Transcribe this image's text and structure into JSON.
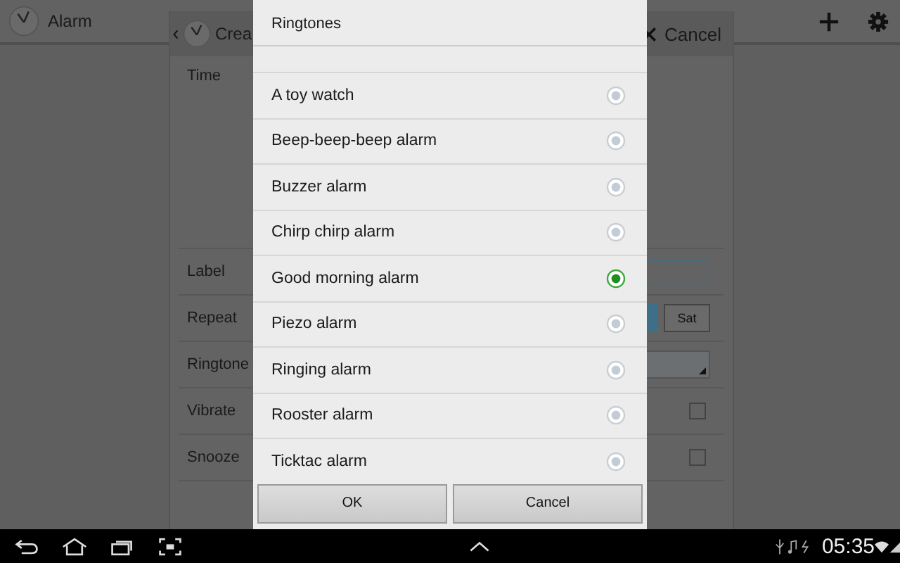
{
  "app_bar": {
    "title": "Alarm"
  },
  "panel": {
    "title": "Crea",
    "cancel": "Cancel",
    "rows": [
      {
        "label": "Time",
        "kind": "time"
      },
      {
        "label": "Label",
        "kind": "field"
      },
      {
        "label": "Repeat",
        "kind": "days",
        "day": "Sat"
      },
      {
        "label": "Ringtone",
        "kind": "dropdown"
      },
      {
        "label": "Vibrate",
        "kind": "checkbox",
        "checked": false
      },
      {
        "label": "Snooze",
        "kind": "checkbox",
        "checked": false
      }
    ]
  },
  "dialog": {
    "title": "Ringtones",
    "items": [
      {
        "label": "A toy watch",
        "selected": false
      },
      {
        "label": "Beep-beep-beep alarm",
        "selected": false
      },
      {
        "label": "Buzzer alarm",
        "selected": false
      },
      {
        "label": "Chirp chirp alarm",
        "selected": false
      },
      {
        "label": "Good morning alarm",
        "selected": true
      },
      {
        "label": "Piezo alarm",
        "selected": false
      },
      {
        "label": "Ringing alarm",
        "selected": false
      },
      {
        "label": "Rooster alarm",
        "selected": false
      },
      {
        "label": "Ticktac alarm",
        "selected": false
      }
    ],
    "buttons": [
      "OK",
      "Cancel"
    ]
  },
  "status_bar": {
    "time": "05:35"
  }
}
